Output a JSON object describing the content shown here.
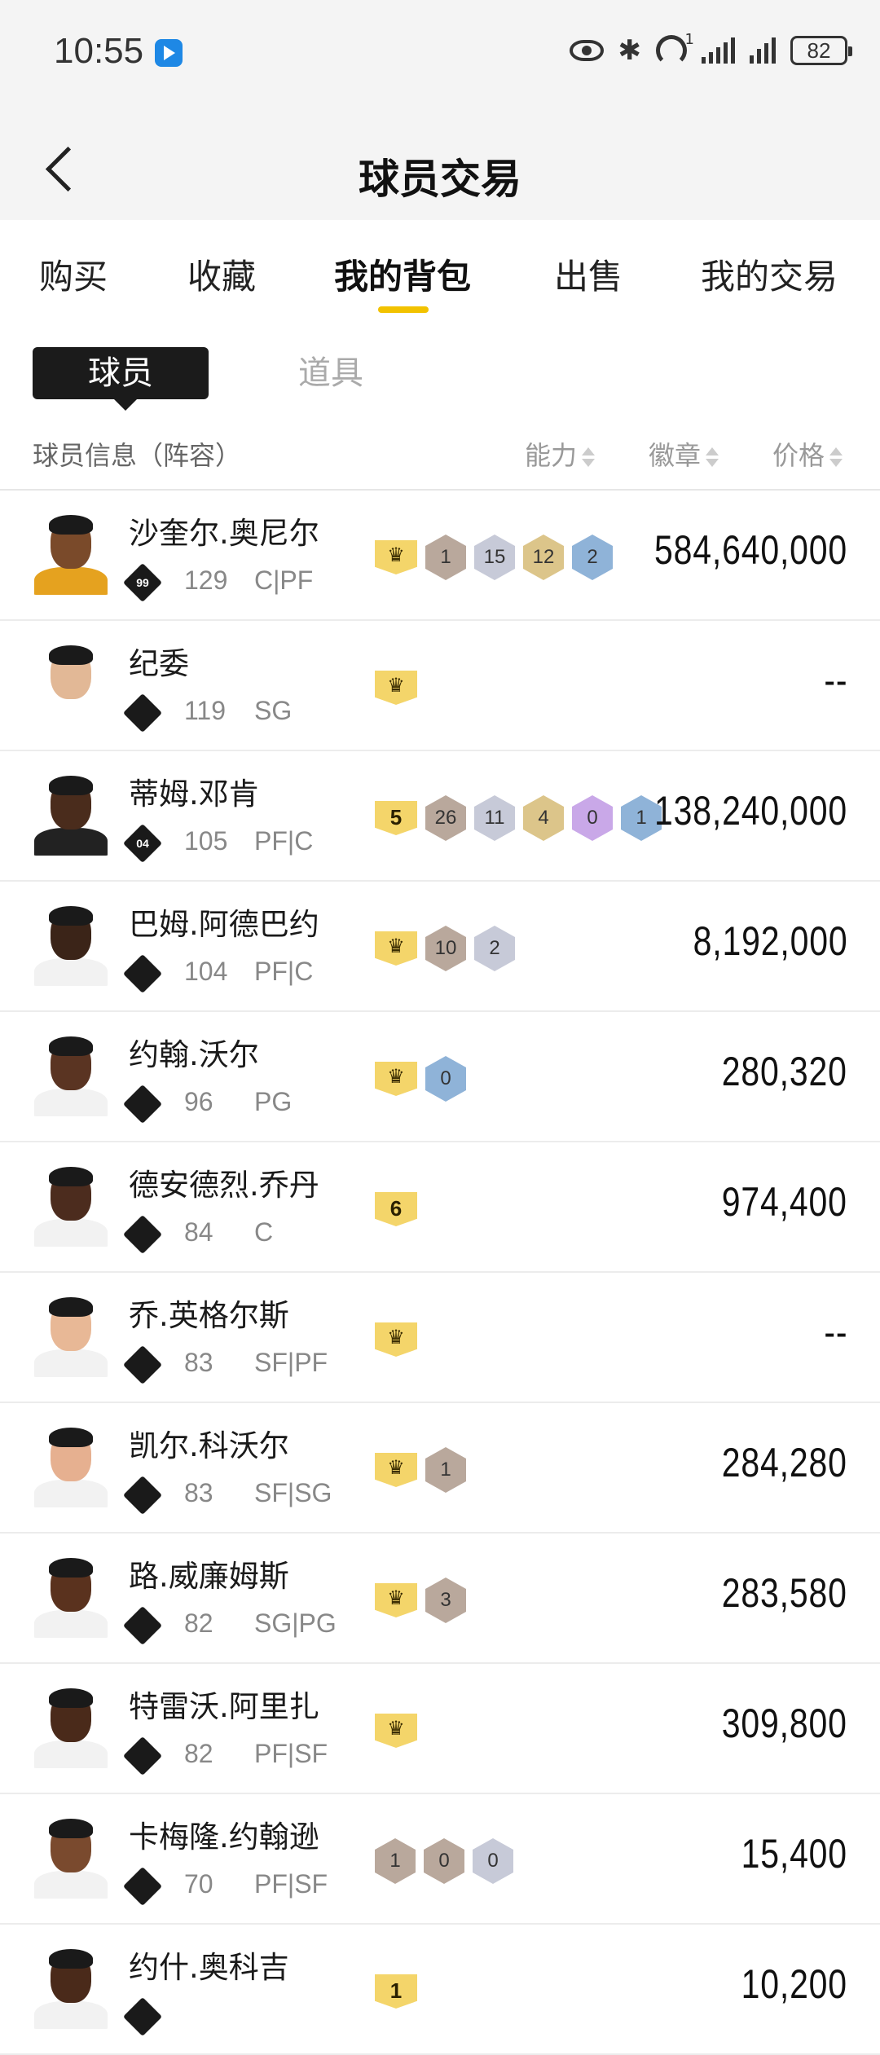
{
  "status_bar": {
    "time": "10:55",
    "battery": "82",
    "wifi_sup": "1"
  },
  "header": {
    "title": "球员交易"
  },
  "tabs": [
    {
      "label": "购买",
      "active": false
    },
    {
      "label": "收藏",
      "active": false
    },
    {
      "label": "我的背包",
      "active": true
    },
    {
      "label": "出售",
      "active": false
    },
    {
      "label": "我的交易",
      "active": false
    }
  ],
  "subtabs": {
    "active": "球员",
    "inactive": "道具"
  },
  "columns": {
    "info": "球员信息（阵容）",
    "ability": "能力",
    "badge": "徽章",
    "price": "价格"
  },
  "colors": {
    "accent": "#f2c200",
    "gold": "#f4d56a",
    "bronze": "#b9a89c",
    "silver": "#c7cad8",
    "gold_hex": "#dcc58a",
    "blue": "#8fb3d8",
    "purple": "#c9a8e8"
  },
  "players": [
    {
      "name": "沙奎尔.奥尼尔",
      "tier": "99",
      "ovr": "129",
      "pos": "C|PF",
      "badges": [
        {
          "t": "crown"
        },
        {
          "t": "hex",
          "v": "1",
          "c": "bronze"
        },
        {
          "t": "hex",
          "v": "15",
          "c": "silver"
        },
        {
          "t": "hex",
          "v": "12",
          "c": "gold_hex"
        },
        {
          "t": "hex",
          "v": "2",
          "c": "blue"
        }
      ],
      "price": "584,640,000",
      "skin": "#7a4a2a",
      "shirt": "#e5a21f"
    },
    {
      "name": "纪委",
      "tier": "",
      "ovr": "119",
      "pos": "SG",
      "badges": [
        {
          "t": "crown"
        }
      ],
      "price": "--",
      "skin": "#e2b896",
      "shirt": "#ffffff"
    },
    {
      "name": "蒂姆.邓肯",
      "tier": "04",
      "ovr": "105",
      "pos": "PF|C",
      "badges": [
        {
          "t": "level",
          "v": "5"
        },
        {
          "t": "hex",
          "v": "26",
          "c": "bronze"
        },
        {
          "t": "hex",
          "v": "11",
          "c": "silver"
        },
        {
          "t": "hex",
          "v": "4",
          "c": "gold_hex"
        },
        {
          "t": "hex",
          "v": "0",
          "c": "purple"
        },
        {
          "t": "hex",
          "v": "1",
          "c": "blue"
        }
      ],
      "price": "138,240,000",
      "skin": "#4a2c1c",
      "shirt": "#222222"
    },
    {
      "name": "巴姆.阿德巴约",
      "tier": "",
      "ovr": "104",
      "pos": "PF|C",
      "badges": [
        {
          "t": "crown"
        },
        {
          "t": "hex",
          "v": "10",
          "c": "bronze"
        },
        {
          "t": "hex",
          "v": "2",
          "c": "silver"
        }
      ],
      "price": "8,192,000",
      "skin": "#3b2418",
      "shirt": "#f2f2f2"
    },
    {
      "name": "约翰.沃尔",
      "tier": "",
      "ovr": "96",
      "pos": "PG",
      "badges": [
        {
          "t": "crown"
        },
        {
          "t": "hex",
          "v": "0",
          "c": "blue"
        }
      ],
      "price": "280,320",
      "skin": "#5a3422",
      "shirt": "#f2f2f2"
    },
    {
      "name": "德安德烈.乔丹",
      "tier": "",
      "ovr": "84",
      "pos": "C",
      "badges": [
        {
          "t": "level",
          "v": "6"
        }
      ],
      "price": "974,400",
      "skin": "#4c2c1e",
      "shirt": "#f2f2f2"
    },
    {
      "name": "乔.英格尔斯",
      "tier": "",
      "ovr": "83",
      "pos": "SF|PF",
      "badges": [
        {
          "t": "crown"
        }
      ],
      "price": "--",
      "skin": "#e8b896",
      "shirt": "#f2f2f2"
    },
    {
      "name": "凯尔.科沃尔",
      "tier": "",
      "ovr": "83",
      "pos": "SF|SG",
      "badges": [
        {
          "t": "crown"
        },
        {
          "t": "hex",
          "v": "1",
          "c": "bronze"
        }
      ],
      "price": "284,280",
      "skin": "#e6b090",
      "shirt": "#f2f2f2"
    },
    {
      "name": "路.威廉姆斯",
      "tier": "",
      "ovr": "82",
      "pos": "SG|PG",
      "badges": [
        {
          "t": "crown"
        },
        {
          "t": "hex",
          "v": "3",
          "c": "bronze"
        }
      ],
      "price": "283,580",
      "skin": "#5a321e",
      "shirt": "#f2f2f2"
    },
    {
      "name": "特雷沃.阿里扎",
      "tier": "",
      "ovr": "82",
      "pos": "PF|SF",
      "badges": [
        {
          "t": "crown"
        }
      ],
      "price": "309,800",
      "skin": "#4a2a1a",
      "shirt": "#f2f2f2"
    },
    {
      "name": "卡梅隆.约翰逊",
      "tier": "",
      "ovr": "70",
      "pos": "PF|SF",
      "badges": [
        {
          "t": "hex",
          "v": "1",
          "c": "bronze"
        },
        {
          "t": "hex",
          "v": "0",
          "c": "bronze"
        },
        {
          "t": "hex",
          "v": "0",
          "c": "silver"
        }
      ],
      "price": "15,400",
      "skin": "#7a4a2e",
      "shirt": "#f2f2f2"
    },
    {
      "name": "约什.奥科吉",
      "tier": "",
      "ovr": "",
      "pos": "",
      "badges": [
        {
          "t": "level",
          "v": "1"
        }
      ],
      "price": "10,200",
      "skin": "#4a2a1a",
      "shirt": "#f2f2f2"
    }
  ]
}
